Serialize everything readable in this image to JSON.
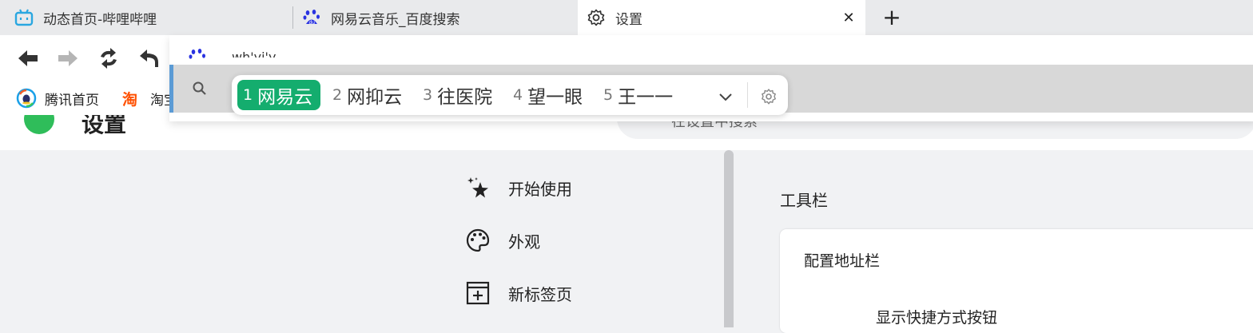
{
  "tabs": [
    {
      "title": "动态首页-哔哩哔哩",
      "icon": "bilibili-icon"
    },
    {
      "title": "网易云音乐_百度搜索",
      "icon": "baidu-paw-icon"
    },
    {
      "title": "设置",
      "icon": "gear-icon",
      "active": true
    }
  ],
  "tab_close": "✕",
  "new_tab": "+",
  "bookmarks": [
    {
      "label": "腾讯首页",
      "icon": "tencent-icon"
    },
    {
      "label": "淘宝",
      "icon": "taobao-icon"
    }
  ],
  "omnibox": {
    "typed_text": "wh'yi'y"
  },
  "ime": {
    "candidates": [
      {
        "num": "1",
        "text": "网易云",
        "selected": true
      },
      {
        "num": "2",
        "text": "网抑云"
      },
      {
        "num": "3",
        "text": "往医院"
      },
      {
        "num": "4",
        "text": "望一眼"
      },
      {
        "num": "5",
        "text": "王一一"
      }
    ]
  },
  "settings": {
    "title": "设置",
    "search_placeholder": "在设置中搜索",
    "nav": [
      {
        "label": "开始使用",
        "icon": "sparkle-star-icon"
      },
      {
        "label": "外观",
        "icon": "palette-icon"
      },
      {
        "label": "新标签页",
        "icon": "new-tab-icon"
      }
    ],
    "section_title": "工具栏",
    "card_title": "配置地址栏",
    "card_row": "显示快捷方式按钮"
  },
  "colors": {
    "ime_selected": "#14ad6e",
    "omnibox_accent": "#5b9bd5",
    "settings_logo": "#2fbd5a"
  }
}
